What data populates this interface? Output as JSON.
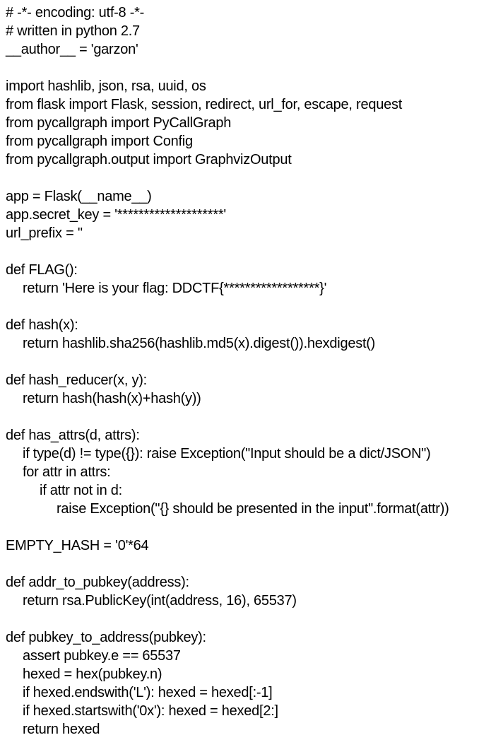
{
  "code_lines": [
    "# -*- encoding: utf-8 -*-",
    "# written in python 2.7",
    "__author__ = 'garzon'",
    "",
    "import hashlib, json, rsa, uuid, os",
    "from flask import Flask, session, redirect, url_for, escape, request",
    "from pycallgraph import PyCallGraph",
    "from pycallgraph import Config",
    "from pycallgraph.output import GraphvizOutput",
    "",
    "app = Flask(__name__)",
    "app.secret_key = '********************'",
    "url_prefix = ''",
    "",
    "def FLAG():",
    "return 'Here is your flag: DDCTF{******************}'",
    "",
    "def hash(x):",
    "return hashlib.sha256(hashlib.md5(x).digest()).hexdigest()",
    "",
    "def hash_reducer(x, y):",
    "return hash(hash(x)+hash(y))",
    "",
    "def has_attrs(d, attrs):",
    "if type(d) != type({}): raise Exception(\"Input should be a dict/JSON\")",
    "for attr in attrs:",
    "if attr not in d:",
    "raise Exception(\"{} should be presented in the input\".format(attr))",
    "",
    "EMPTY_HASH = '0'*64",
    "",
    "def addr_to_pubkey(address):",
    "return rsa.PublicKey(int(address, 16), 65537)",
    "",
    "def pubkey_to_address(pubkey):",
    "assert pubkey.e == 65537",
    "hexed = hex(pubkey.n)",
    "if hexed.endswith('L'): hexed = hexed[:-1]",
    "if hexed.startswith('0x'): hexed = hexed[2:]",
    "return hexed"
  ]
}
